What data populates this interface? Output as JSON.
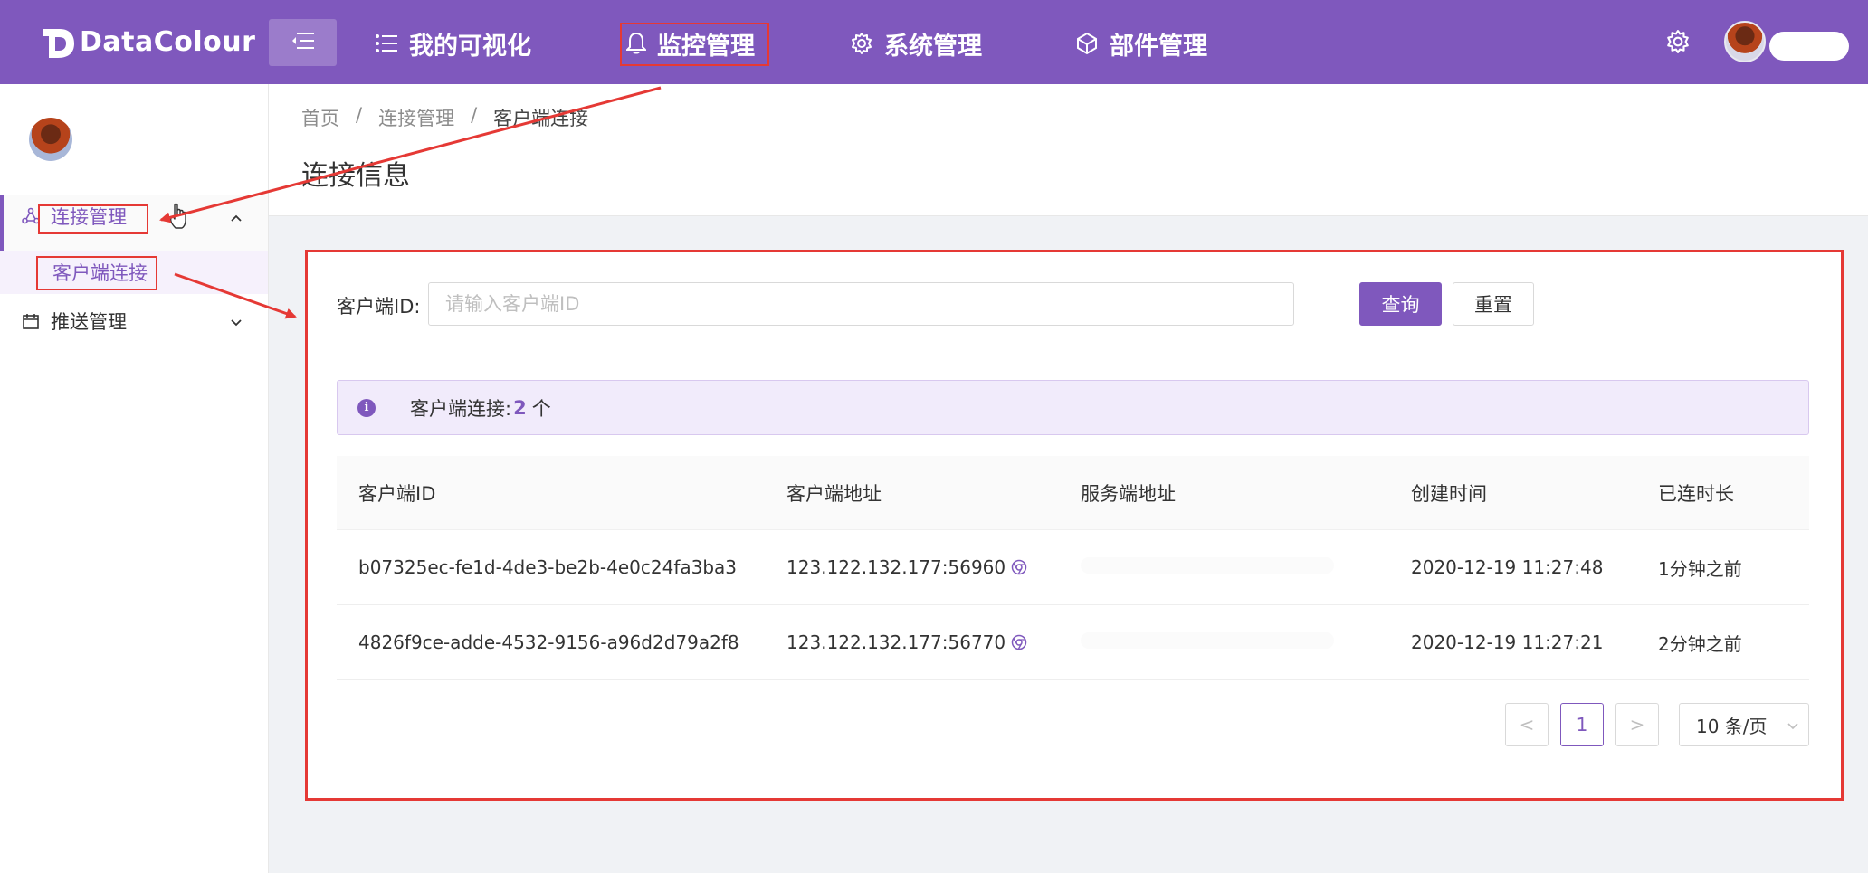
{
  "header": {
    "logo_text": "DataColour",
    "nav": [
      {
        "label": "我的可视化",
        "icon": "list-icon"
      },
      {
        "label": "监控管理",
        "icon": "bell-icon",
        "active": true
      },
      {
        "label": "系统管理",
        "icon": "gear-icon"
      },
      {
        "label": "部件管理",
        "icon": "cube-icon"
      }
    ],
    "brand_color": "#7f58bd"
  },
  "sidebar": {
    "items": [
      {
        "label": "连接管理",
        "icon": "share-nodes-icon",
        "expanded": true
      },
      {
        "label": "客户端连接",
        "selected": true
      },
      {
        "label": "推送管理",
        "icon": "calendar-icon",
        "expanded": false
      }
    ]
  },
  "breadcrumb": {
    "items": [
      "首页",
      "连接管理",
      "客户端连接"
    ],
    "separator": "/"
  },
  "page": {
    "title": "连接信息"
  },
  "search": {
    "label": "客户端ID:",
    "placeholder": "请输入客户端ID",
    "value": "",
    "query_button": "查询",
    "reset_button": "重置"
  },
  "alert": {
    "prefix": "客户端连接:",
    "count": "2",
    "suffix": "个"
  },
  "table": {
    "columns": [
      "客户端ID",
      "客户端地址",
      "服务端地址",
      "创建时间",
      "已连时长"
    ],
    "rows": [
      {
        "client_id": "b07325ec-fe1d-4de3-be2b-4e0c24fa3ba3",
        "client_addr": "123.122.132.177:56960",
        "server_addr": "",
        "created": "2020-12-19 11:27:48",
        "duration": "1分钟之前"
      },
      {
        "client_id": "4826f9ce-adde-4532-9156-a96d2d79a2f8",
        "client_addr": "123.122.132.177:56770",
        "server_addr": "",
        "created": "2020-12-19 11:27:21",
        "duration": "2分钟之前"
      }
    ]
  },
  "pagination": {
    "prev": "<",
    "current": "1",
    "next": ">",
    "page_size": "10 条/页"
  }
}
